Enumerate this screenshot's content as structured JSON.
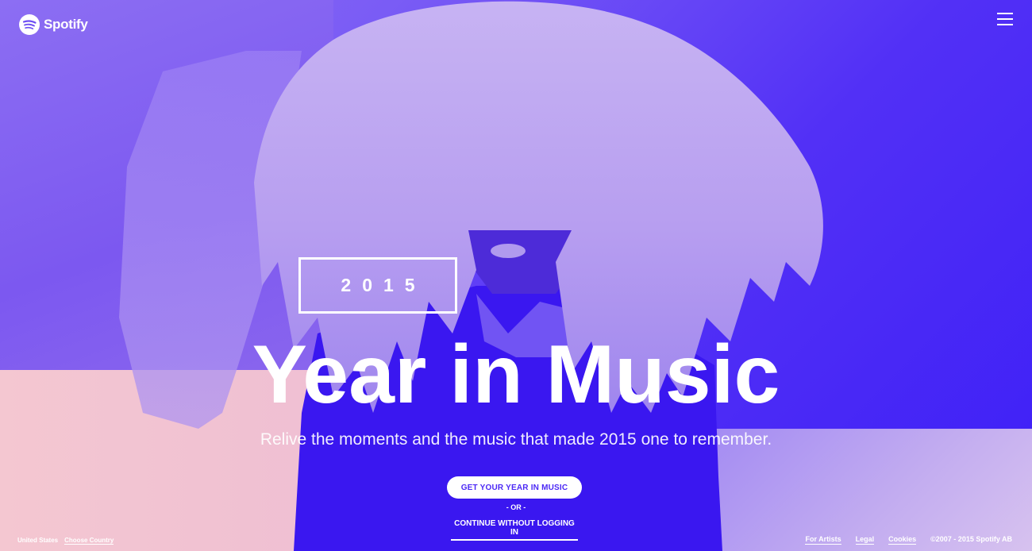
{
  "brand": {
    "name": "Spotify",
    "logo_icon": "spotify-logo-icon"
  },
  "header": {
    "menu_icon": "hamburger-menu-icon"
  },
  "hero": {
    "year": "2015",
    "title": "Year in Music",
    "subtitle": "Relive the moments and the music that made 2015 one to remember.",
    "primary_cta": "GET YOUR YEAR IN MUSIC",
    "separator": "- OR -",
    "secondary_cta": "CONTINUE WITHOUT LOGGING IN"
  },
  "footer": {
    "country": "United States",
    "choose_country": "Choose Country",
    "links": [
      "For Artists",
      "Legal",
      "Cookies"
    ],
    "copyright": "©2007 - 2015 Spotify AB"
  },
  "colors": {
    "accent": "#4b28f5",
    "background_gradient_start": "#8f6af2",
    "background_gradient_end": "#3d1ff7",
    "pink_panel": "#f4c7d1",
    "text": "#ffffff"
  }
}
